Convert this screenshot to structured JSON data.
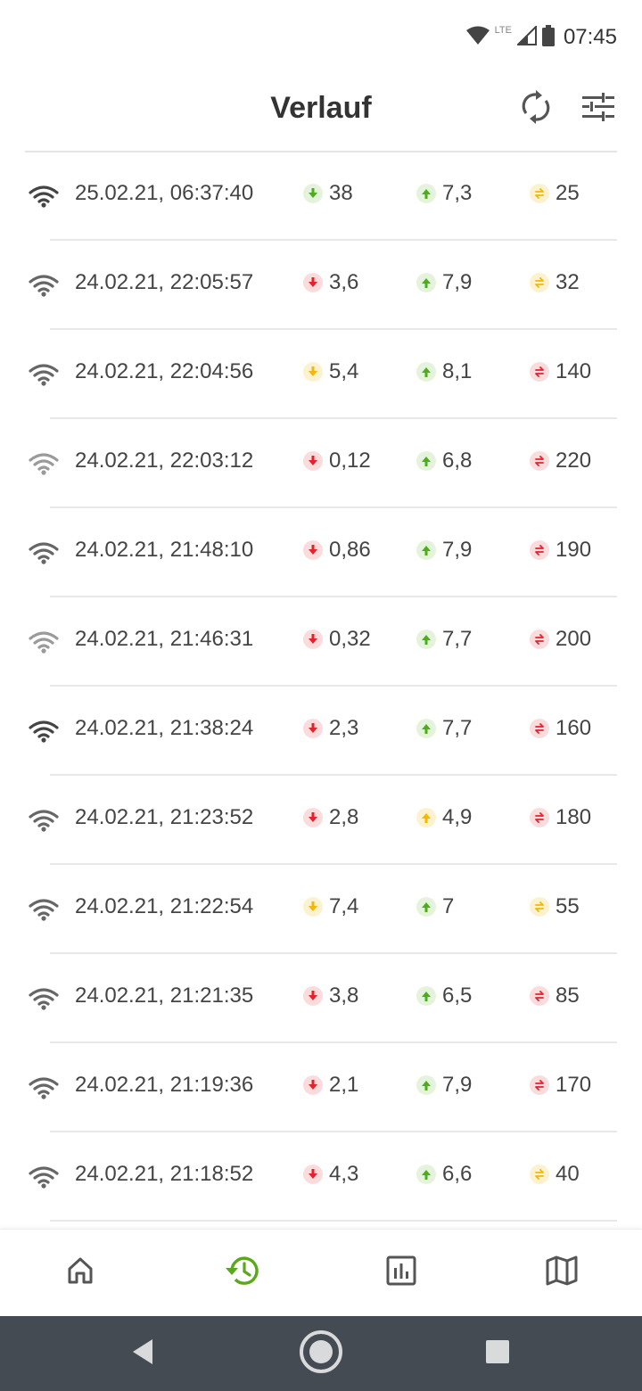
{
  "status_bar": {
    "time": "07:45",
    "network_label": "LTE",
    "icons": [
      "wifi-icon",
      "signal-icon",
      "battery-icon"
    ]
  },
  "header": {
    "title": "Verlauf",
    "refresh_icon": "refresh-icon",
    "filter_icon": "tune-icon"
  },
  "colors": {
    "good": "#4caf1a",
    "good_bg": "#e6f3dc",
    "medium": "#f5b800",
    "medium_bg": "#fdf2cf",
    "bad": "#e8202a",
    "bad_bg": "#fbdcdd",
    "active_nav": "#5aa81e",
    "inactive_nav": "#555555"
  },
  "history": {
    "rows": [
      {
        "timestamp": "25.02.21, 06:37:40",
        "download": "38",
        "download_status": "good",
        "upload": "7,3",
        "upload_status": "good",
        "ping": "25",
        "ping_status": "medium",
        "wifi_level": 4
      },
      {
        "timestamp": "24.02.21, 22:05:57",
        "download": "3,6",
        "download_status": "bad",
        "upload": "7,9",
        "upload_status": "good",
        "ping": "32",
        "ping_status": "medium",
        "wifi_level": 3
      },
      {
        "timestamp": "24.02.21, 22:04:56",
        "download": "5,4",
        "download_status": "medium",
        "upload": "8,1",
        "upload_status": "good",
        "ping": "140",
        "ping_status": "bad",
        "wifi_level": 3
      },
      {
        "timestamp": "24.02.21, 22:03:12",
        "download": "0,12",
        "download_status": "bad",
        "upload": "6,8",
        "upload_status": "good",
        "ping": "220",
        "ping_status": "bad",
        "wifi_level": 2
      },
      {
        "timestamp": "24.02.21, 21:48:10",
        "download": "0,86",
        "download_status": "bad",
        "upload": "7,9",
        "upload_status": "good",
        "ping": "190",
        "ping_status": "bad",
        "wifi_level": 3
      },
      {
        "timestamp": "24.02.21, 21:46:31",
        "download": "0,32",
        "download_status": "bad",
        "upload": "7,7",
        "upload_status": "good",
        "ping": "200",
        "ping_status": "bad",
        "wifi_level": 2
      },
      {
        "timestamp": "24.02.21, 21:38:24",
        "download": "2,3",
        "download_status": "bad",
        "upload": "7,7",
        "upload_status": "good",
        "ping": "160",
        "ping_status": "bad",
        "wifi_level": 4
      },
      {
        "timestamp": "24.02.21, 21:23:52",
        "download": "2,8",
        "download_status": "bad",
        "upload": "4,9",
        "upload_status": "medium",
        "ping": "180",
        "ping_status": "bad",
        "wifi_level": 3
      },
      {
        "timestamp": "24.02.21, 21:22:54",
        "download": "7,4",
        "download_status": "medium",
        "upload": "7",
        "upload_status": "good",
        "ping": "55",
        "ping_status": "medium",
        "wifi_level": 3
      },
      {
        "timestamp": "24.02.21, 21:21:35",
        "download": "3,8",
        "download_status": "bad",
        "upload": "6,5",
        "upload_status": "good",
        "ping": "85",
        "ping_status": "bad",
        "wifi_level": 3
      },
      {
        "timestamp": "24.02.21, 21:19:36",
        "download": "2,1",
        "download_status": "bad",
        "upload": "7,9",
        "upload_status": "good",
        "ping": "170",
        "ping_status": "bad",
        "wifi_level": 3
      },
      {
        "timestamp": "24.02.21, 21:18:52",
        "download": "4,3",
        "download_status": "bad",
        "upload": "6,6",
        "upload_status": "good",
        "ping": "40",
        "ping_status": "medium",
        "wifi_level": 3
      }
    ]
  },
  "bottom_nav": {
    "items": [
      {
        "icon": "home-icon",
        "active": false
      },
      {
        "icon": "history-icon",
        "active": true
      },
      {
        "icon": "statistics-icon",
        "active": false
      },
      {
        "icon": "map-icon",
        "active": false
      }
    ]
  },
  "system_nav": {
    "buttons": [
      "back-icon",
      "home-circle-icon",
      "recents-icon"
    ]
  }
}
